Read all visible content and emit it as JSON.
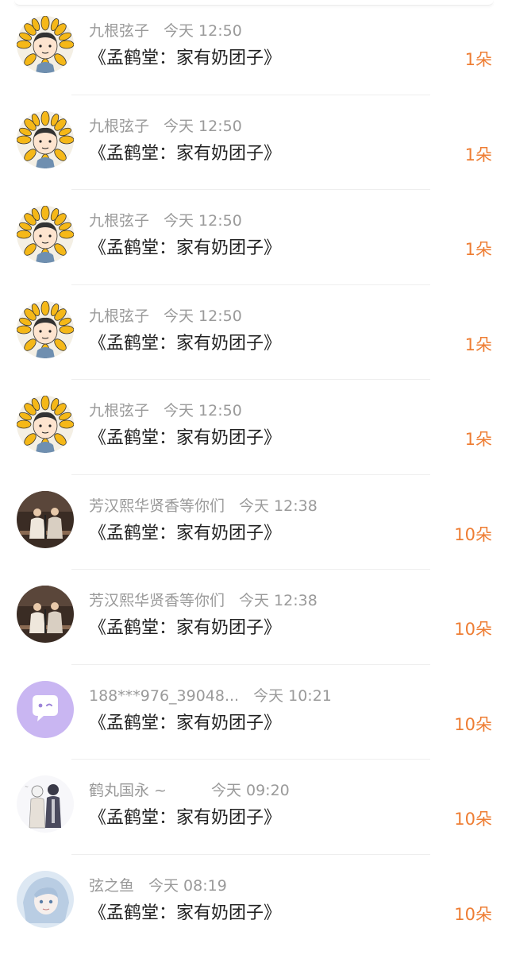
{
  "colors": {
    "accent": "#ee7d33",
    "text": "#222222",
    "secondary": "#9a9a9a"
  },
  "rows": [
    {
      "user": "九根弦子",
      "time": "今天 12:50",
      "gift": "《孟鹤堂：家有奶团子》",
      "count": "1朵",
      "avatar": "sunflower-avatar"
    },
    {
      "user": "九根弦子",
      "time": "今天 12:50",
      "gift": "《孟鹤堂：家有奶团子》",
      "count": "1朵",
      "avatar": "sunflower-avatar"
    },
    {
      "user": "九根弦子",
      "time": "今天 12:50",
      "gift": "《孟鹤堂：家有奶团子》",
      "count": "1朵",
      "avatar": "sunflower-avatar"
    },
    {
      "user": "九根弦子",
      "time": "今天 12:50",
      "gift": "《孟鹤堂：家有奶团子》",
      "count": "1朵",
      "avatar": "sunflower-avatar"
    },
    {
      "user": "九根弦子",
      "time": "今天 12:50",
      "gift": "《孟鹤堂：家有奶团子》",
      "count": "1朵",
      "avatar": "sunflower-avatar"
    },
    {
      "user": "芳汉熙华贤香等你们",
      "time": "今天 12:38",
      "gift": "《孟鹤堂：家有奶团子》",
      "count": "10朵",
      "avatar": "stage-photo-avatar"
    },
    {
      "user": "芳汉熙华贤香等你们",
      "time": "今天 12:38",
      "gift": "《孟鹤堂：家有奶团子》",
      "count": "10朵",
      "avatar": "stage-photo-avatar"
    },
    {
      "user": "188***976_39048...",
      "time": "今天 10:21",
      "gift": "《孟鹤堂：家有奶团子》",
      "count": "10朵",
      "avatar": "chat-bubble-avatar"
    },
    {
      "user": "鹤丸国永 ~",
      "time": "今天 09:20",
      "gift": "《孟鹤堂：家有奶团子》",
      "count": "10朵",
      "avatar": "anime-sketch-avatar"
    },
    {
      "user": "弦之鱼",
      "time": "今天 08:19",
      "gift": "《孟鹤堂：家有奶团子》",
      "count": "10朵",
      "avatar": "anime-girl-avatar"
    }
  ]
}
